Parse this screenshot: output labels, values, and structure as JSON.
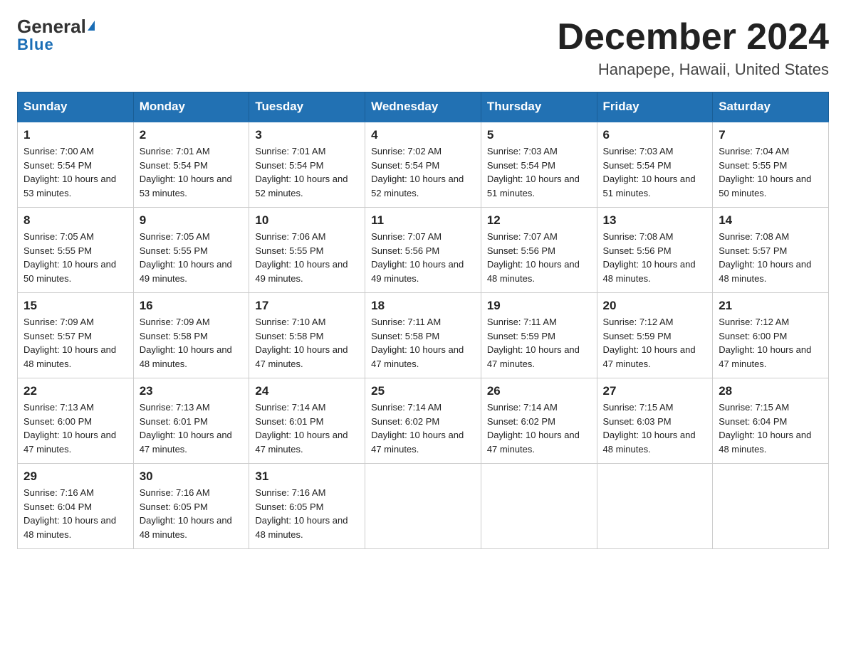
{
  "header": {
    "logo_general": "General",
    "logo_blue": "Blue",
    "month_title": "December 2024",
    "location": "Hanapepe, Hawaii, United States"
  },
  "days_of_week": [
    "Sunday",
    "Monday",
    "Tuesday",
    "Wednesday",
    "Thursday",
    "Friday",
    "Saturday"
  ],
  "weeks": [
    [
      {
        "day": "1",
        "sunrise": "7:00 AM",
        "sunset": "5:54 PM",
        "daylight": "10 hours and 53 minutes."
      },
      {
        "day": "2",
        "sunrise": "7:01 AM",
        "sunset": "5:54 PM",
        "daylight": "10 hours and 53 minutes."
      },
      {
        "day": "3",
        "sunrise": "7:01 AM",
        "sunset": "5:54 PM",
        "daylight": "10 hours and 52 minutes."
      },
      {
        "day": "4",
        "sunrise": "7:02 AM",
        "sunset": "5:54 PM",
        "daylight": "10 hours and 52 minutes."
      },
      {
        "day": "5",
        "sunrise": "7:03 AM",
        "sunset": "5:54 PM",
        "daylight": "10 hours and 51 minutes."
      },
      {
        "day": "6",
        "sunrise": "7:03 AM",
        "sunset": "5:54 PM",
        "daylight": "10 hours and 51 minutes."
      },
      {
        "day": "7",
        "sunrise": "7:04 AM",
        "sunset": "5:55 PM",
        "daylight": "10 hours and 50 minutes."
      }
    ],
    [
      {
        "day": "8",
        "sunrise": "7:05 AM",
        "sunset": "5:55 PM",
        "daylight": "10 hours and 50 minutes."
      },
      {
        "day": "9",
        "sunrise": "7:05 AM",
        "sunset": "5:55 PM",
        "daylight": "10 hours and 49 minutes."
      },
      {
        "day": "10",
        "sunrise": "7:06 AM",
        "sunset": "5:55 PM",
        "daylight": "10 hours and 49 minutes."
      },
      {
        "day": "11",
        "sunrise": "7:07 AM",
        "sunset": "5:56 PM",
        "daylight": "10 hours and 49 minutes."
      },
      {
        "day": "12",
        "sunrise": "7:07 AM",
        "sunset": "5:56 PM",
        "daylight": "10 hours and 48 minutes."
      },
      {
        "day": "13",
        "sunrise": "7:08 AM",
        "sunset": "5:56 PM",
        "daylight": "10 hours and 48 minutes."
      },
      {
        "day": "14",
        "sunrise": "7:08 AM",
        "sunset": "5:57 PM",
        "daylight": "10 hours and 48 minutes."
      }
    ],
    [
      {
        "day": "15",
        "sunrise": "7:09 AM",
        "sunset": "5:57 PM",
        "daylight": "10 hours and 48 minutes."
      },
      {
        "day": "16",
        "sunrise": "7:09 AM",
        "sunset": "5:58 PM",
        "daylight": "10 hours and 48 minutes."
      },
      {
        "day": "17",
        "sunrise": "7:10 AM",
        "sunset": "5:58 PM",
        "daylight": "10 hours and 47 minutes."
      },
      {
        "day": "18",
        "sunrise": "7:11 AM",
        "sunset": "5:58 PM",
        "daylight": "10 hours and 47 minutes."
      },
      {
        "day": "19",
        "sunrise": "7:11 AM",
        "sunset": "5:59 PM",
        "daylight": "10 hours and 47 minutes."
      },
      {
        "day": "20",
        "sunrise": "7:12 AM",
        "sunset": "5:59 PM",
        "daylight": "10 hours and 47 minutes."
      },
      {
        "day": "21",
        "sunrise": "7:12 AM",
        "sunset": "6:00 PM",
        "daylight": "10 hours and 47 minutes."
      }
    ],
    [
      {
        "day": "22",
        "sunrise": "7:13 AM",
        "sunset": "6:00 PM",
        "daylight": "10 hours and 47 minutes."
      },
      {
        "day": "23",
        "sunrise": "7:13 AM",
        "sunset": "6:01 PM",
        "daylight": "10 hours and 47 minutes."
      },
      {
        "day": "24",
        "sunrise": "7:14 AM",
        "sunset": "6:01 PM",
        "daylight": "10 hours and 47 minutes."
      },
      {
        "day": "25",
        "sunrise": "7:14 AM",
        "sunset": "6:02 PM",
        "daylight": "10 hours and 47 minutes."
      },
      {
        "day": "26",
        "sunrise": "7:14 AM",
        "sunset": "6:02 PM",
        "daylight": "10 hours and 47 minutes."
      },
      {
        "day": "27",
        "sunrise": "7:15 AM",
        "sunset": "6:03 PM",
        "daylight": "10 hours and 48 minutes."
      },
      {
        "day": "28",
        "sunrise": "7:15 AM",
        "sunset": "6:04 PM",
        "daylight": "10 hours and 48 minutes."
      }
    ],
    [
      {
        "day": "29",
        "sunrise": "7:16 AM",
        "sunset": "6:04 PM",
        "daylight": "10 hours and 48 minutes."
      },
      {
        "day": "30",
        "sunrise": "7:16 AM",
        "sunset": "6:05 PM",
        "daylight": "10 hours and 48 minutes."
      },
      {
        "day": "31",
        "sunrise": "7:16 AM",
        "sunset": "6:05 PM",
        "daylight": "10 hours and 48 minutes."
      },
      null,
      null,
      null,
      null
    ]
  ],
  "labels": {
    "sunrise_prefix": "Sunrise: ",
    "sunset_prefix": "Sunset: ",
    "daylight_prefix": "Daylight: "
  }
}
